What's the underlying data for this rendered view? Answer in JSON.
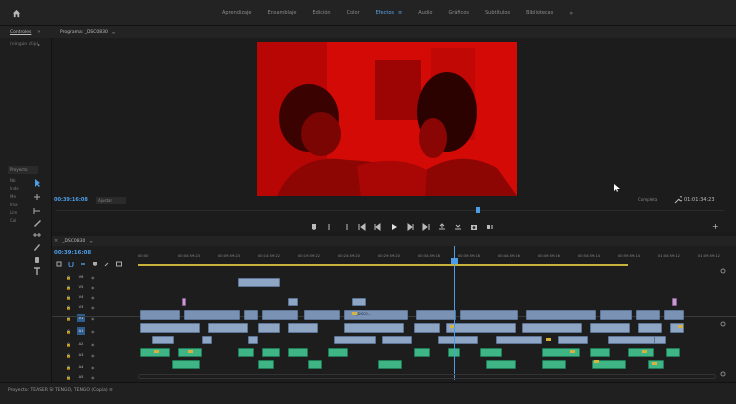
{
  "topbar": {
    "workspaces": [
      "Aprendizaje",
      "Ensamblaje",
      "Edición",
      "Color",
      "Efectos",
      "Audio",
      "Gráficos",
      "Subtítulos",
      "Bibliotecas"
    ],
    "active_index": 4,
    "overflow": "»"
  },
  "left_panel": {
    "tab_label": "Controles",
    "tab_overflow": "»",
    "field": "(ningún clip)",
    "field_arrow": "▸",
    "bottom_header": "Proyecto",
    "rows": [
      "Nb",
      "Inde",
      "Me",
      "Ima",
      "Lim",
      "Cal"
    ]
  },
  "program_monitor": {
    "label": "Programa: _DSC0830",
    "menu": "≡",
    "timecode_current": "00:39:16:08",
    "fit": "Ajustar",
    "quality": "Completa",
    "timecode_duration": "01:01:34:23",
    "add": "+"
  },
  "timeline": {
    "close": "×",
    "sequence_label": "_DSC0830",
    "sequence_menu": "≡",
    "timecode": "00:39:16:08",
    "ruler_labels": [
      "00:00",
      "00:04:59:23",
      "00:09:59:23",
      "00:14:59:22",
      "00:19:59:22",
      "00:24:59:20",
      "00:29:59:20",
      "00:34:59:18",
      "00:39:59:18",
      "00:44:59:16",
      "00:49:59:16",
      "00:54:59:14",
      "00:59:59:14",
      "01:04:59:12",
      "01:09:59:12"
    ],
    "tracks": [
      {
        "label": "V6",
        "selected": false
      },
      {
        "label": "V5",
        "selected": false
      },
      {
        "label": "V4",
        "selected": false
      },
      {
        "label": "V3",
        "selected": false
      },
      {
        "label": "V1",
        "selected": true
      },
      {
        "label": "A1",
        "selected": true
      },
      {
        "label": "A2",
        "selected": false
      },
      {
        "label": "A3",
        "selected": false
      },
      {
        "label": "A4",
        "selected": false
      },
      {
        "label": "A5",
        "selected": false
      }
    ],
    "clip_name": "_DSC0...",
    "colors": {
      "video_clip": "#8ea6c4",
      "audio_clip": "#3fb585",
      "playhead": "#4d9ce6",
      "work_area": "#c8b23a",
      "frame_tint": "#d30a05"
    }
  },
  "bottom": {
    "project_tab": "Proyecto: TEASER SI TENGO, TENGO (Copia) ≡"
  }
}
